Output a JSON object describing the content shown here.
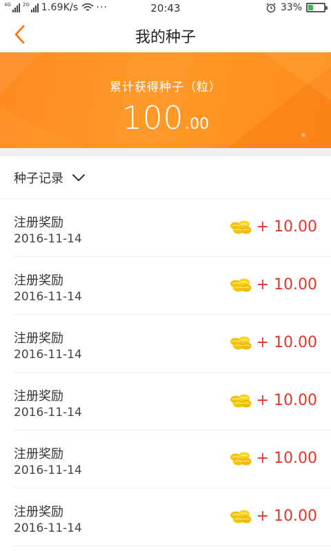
{
  "status_bar": {
    "signal1_tag": "4G",
    "signal2_tag": "2G",
    "speed": "1.69K/s",
    "dots": "···",
    "time": "20:43",
    "battery_percent": "33%",
    "battery_level": 0.33,
    "battery_color": "#2fbf4a"
  },
  "header": {
    "title": "我的种子",
    "back_icon": "chevron-left-icon",
    "accent_color": "#ff6a00"
  },
  "summary": {
    "label": "累计获得种子（粒）",
    "amount_integer": "100",
    "amount_decimal": ".00",
    "background_color": "#ff9a2a"
  },
  "records": {
    "header_label": "种子记录",
    "dropdown_icon": "chevron-down-icon",
    "items": [
      {
        "title": "注册奖励",
        "date": "2016-11-14",
        "amount": "+ 10.00"
      },
      {
        "title": "注册奖励",
        "date": "2016-11-14",
        "amount": "+ 10.00"
      },
      {
        "title": "注册奖励",
        "date": "2016-11-14",
        "amount": "+ 10.00"
      },
      {
        "title": "注册奖励",
        "date": "2016-11-14",
        "amount": "+ 10.00"
      },
      {
        "title": "注册奖励",
        "date": "2016-11-14",
        "amount": "+ 10.00"
      },
      {
        "title": "注册奖励",
        "date": "2016-11-14",
        "amount": "+ 10.00"
      }
    ],
    "amount_color": "#e8322b",
    "seed_icon": "seeds-icon",
    "seed_color": "#f5c400"
  }
}
